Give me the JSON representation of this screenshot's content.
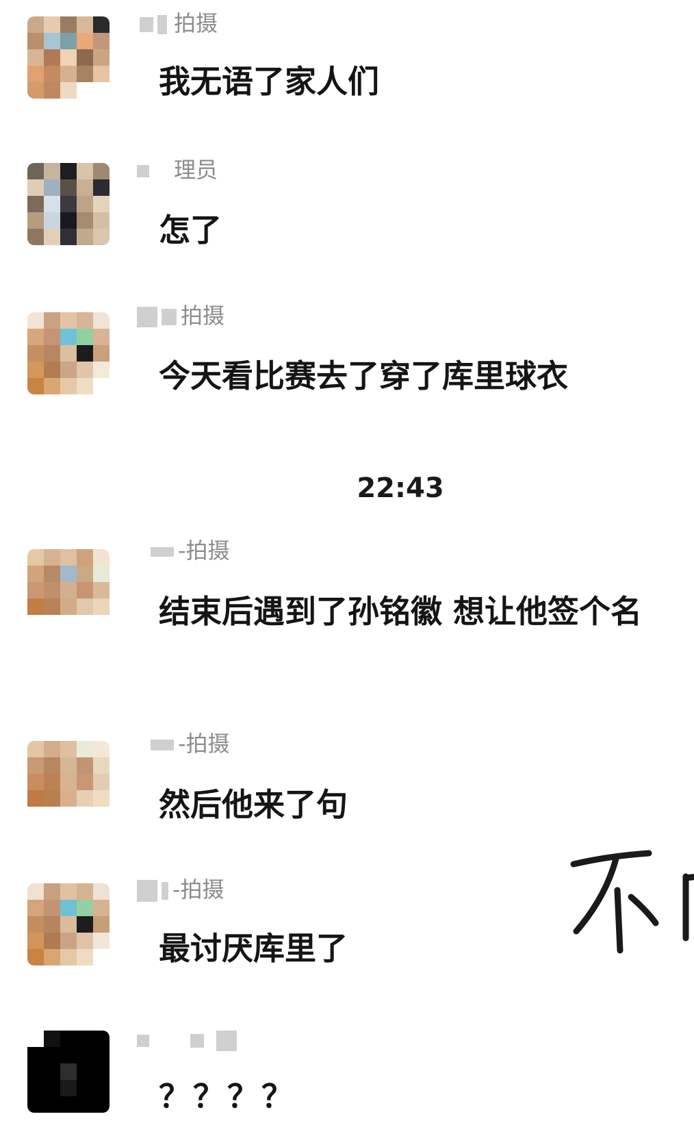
{
  "chat": {
    "time_divider": "22:43",
    "messages": [
      {
        "name": "拍摄",
        "text": "我无语了家人们",
        "palette": [
          "#c9a98a",
          "#e6cbb0",
          "#9a7b63",
          "#d9b899",
          "#2a2a2a",
          "#b98f6e",
          "#a7c4d4",
          "#7d9fa8",
          "#e8a878",
          "#c1967a",
          "#d8b595",
          "#b17a55",
          "#f0d2b4",
          "#8c6a4e",
          "#caa584",
          "#e0a070",
          "#c58a60",
          "#d5b28f",
          "#a9825f",
          "#e5c5a4",
          "#d49a6a",
          "#be8861",
          "#efd9c2",
          "#ffffff",
          "#ffffff"
        ]
      },
      {
        "name": "理员",
        "text": "怎了",
        "palette": [
          "#6e6458",
          "#c7b49c",
          "#1e1e22",
          "#d8c3a8",
          "#a08870",
          "#e0cdb5",
          "#9fb1c0",
          "#5a5048",
          "#c9b095",
          "#2b2b30",
          "#7c6a5a",
          "#d6e0e8",
          "#3a3a40",
          "#bca488",
          "#e5d2bb",
          "#b79c80",
          "#c8d6df",
          "#1a1a1e",
          "#a68b6e",
          "#d4bfa4",
          "#8d7760",
          "#e2cfb8",
          "#2f2f35",
          "#c1a98e",
          "#d9c6ad"
        ]
      },
      {
        "name": "拍摄",
        "text": "今天看比赛去了穿了库里球衣",
        "palette": [
          "#f2e4d4",
          "#caa283",
          "#e2c4a4",
          "#d8b596",
          "#efe4d7",
          "#d6a77c",
          "#c49474",
          "#6fc2d8",
          "#8fd0a0",
          "#d9b393",
          "#c58f62",
          "#b68760",
          "#dcbfa0",
          "#1c1c1c",
          "#c9a07a",
          "#d3965c",
          "#b27c55",
          "#cda586",
          "#e0c5aa",
          "#f4e8d8",
          "#c98443",
          "#d9a772",
          "#e8c9a6",
          "#f1dcc4",
          "#ffffff"
        ]
      },
      {
        "name": "-拍摄",
        "text": "结束后遇到了孙铭徽 想让他签个名",
        "palette": [
          "#e5c7a6",
          "#d6b290",
          "#e1c09f",
          "#cfa27c",
          "#f3e2cf",
          "#d2a37c",
          "#b58a66",
          "#a3b8c8",
          "#c9a886",
          "#e6ead6",
          "#cb9873",
          "#c08f6b",
          "#d2b08f",
          "#c79670",
          "#d9b899",
          "#c27c45",
          "#b88259",
          "#d2ab87",
          "#e1c7ab",
          "#edd5ba",
          "#ffffff",
          "#ffffff",
          "#ffffff",
          "#ffffff",
          "#ffffff"
        ]
      },
      {
        "name": "-拍摄",
        "text": "然后他来了句",
        "palette": [
          "#e3c6a5",
          "#d4ad8a",
          "#dfbfa0",
          "#e9ebd8",
          "#f5e7d6",
          "#c99a74",
          "#b58861",
          "#d7b693",
          "#bf9573",
          "#e8d8c0",
          "#c88d5f",
          "#be8156",
          "#d7b38f",
          "#c89873",
          "#e3ccb2",
          "#c07a44",
          "#b7804f",
          "#d8b08c",
          "#e6cfb4",
          "#f0dcc3",
          "#ffffff",
          "#ffffff",
          "#ffffff",
          "#ffffff",
          "#ffffff"
        ]
      },
      {
        "name": "-拍摄",
        "text": "最讨厌库里了",
        "palette": [
          "#f0e1d0",
          "#c89f80",
          "#e0c2a2",
          "#d5b292",
          "#eee2d4",
          "#d4a47a",
          "#c39373",
          "#70c0d5",
          "#92cfa2",
          "#d8b191",
          "#c38d60",
          "#b5855e",
          "#dabc9d",
          "#1d1d1d",
          "#c89e78",
          "#d1945a",
          "#b07a53",
          "#cba384",
          "#dec3a8",
          "#f3e6d6",
          "#c88242",
          "#d8a570",
          "#e6c7a4",
          "#f0dac2",
          "#ffffff"
        ]
      },
      {
        "name": "",
        "text": "？？？？",
        "palette": [
          "#ffffff",
          "#111111",
          "#000000",
          "#000000",
          "#000000",
          "#000000",
          "#000000",
          "#000000",
          "#000000",
          "#000000",
          "#000000",
          "#000000",
          "#2e2e2e",
          "#000000",
          "#000000",
          "#000000",
          "#000000",
          "#1a1a1a",
          "#000000",
          "#000000",
          "#000000",
          "#000000",
          "#000000",
          "#000000",
          "#000000"
        ]
      }
    ]
  },
  "overlay": {
    "handwriting_text": "不"
  }
}
